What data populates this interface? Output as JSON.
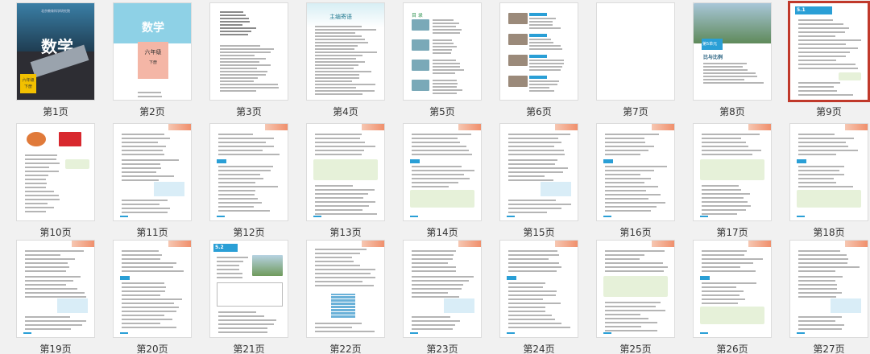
{
  "cover": {
    "title": "数学",
    "grade": "六年级",
    "volume": "下册",
    "publisher": "北京教育科学研究院"
  },
  "cover2": {
    "title": "数学",
    "grade": "六年级",
    "volume": "下册"
  },
  "page4_heading": "主编寄语",
  "page5_heading": "目 录",
  "page8_unit": "第5单元",
  "page8_title": "比与比例",
  "page9_section": "5.1",
  "page21_section": "5.2",
  "selected_page": "第9页",
  "pages": [
    {
      "label": "第1页"
    },
    {
      "label": "第2页"
    },
    {
      "label": "第3页"
    },
    {
      "label": "第4页"
    },
    {
      "label": "第5页"
    },
    {
      "label": "第6页"
    },
    {
      "label": "第7页"
    },
    {
      "label": "第8页"
    },
    {
      "label": "第9页"
    },
    {
      "label": "第10页"
    },
    {
      "label": "第11页"
    },
    {
      "label": "第12页"
    },
    {
      "label": "第13页"
    },
    {
      "label": "第14页"
    },
    {
      "label": "第15页"
    },
    {
      "label": "第16页"
    },
    {
      "label": "第17页"
    },
    {
      "label": "第18页"
    },
    {
      "label": "第19页"
    },
    {
      "label": "第20页"
    },
    {
      "label": "第21页"
    },
    {
      "label": "第22页"
    },
    {
      "label": "第23页"
    },
    {
      "label": "第24页"
    },
    {
      "label": "第25页"
    },
    {
      "label": "第26页"
    },
    {
      "label": "第27页"
    }
  ]
}
